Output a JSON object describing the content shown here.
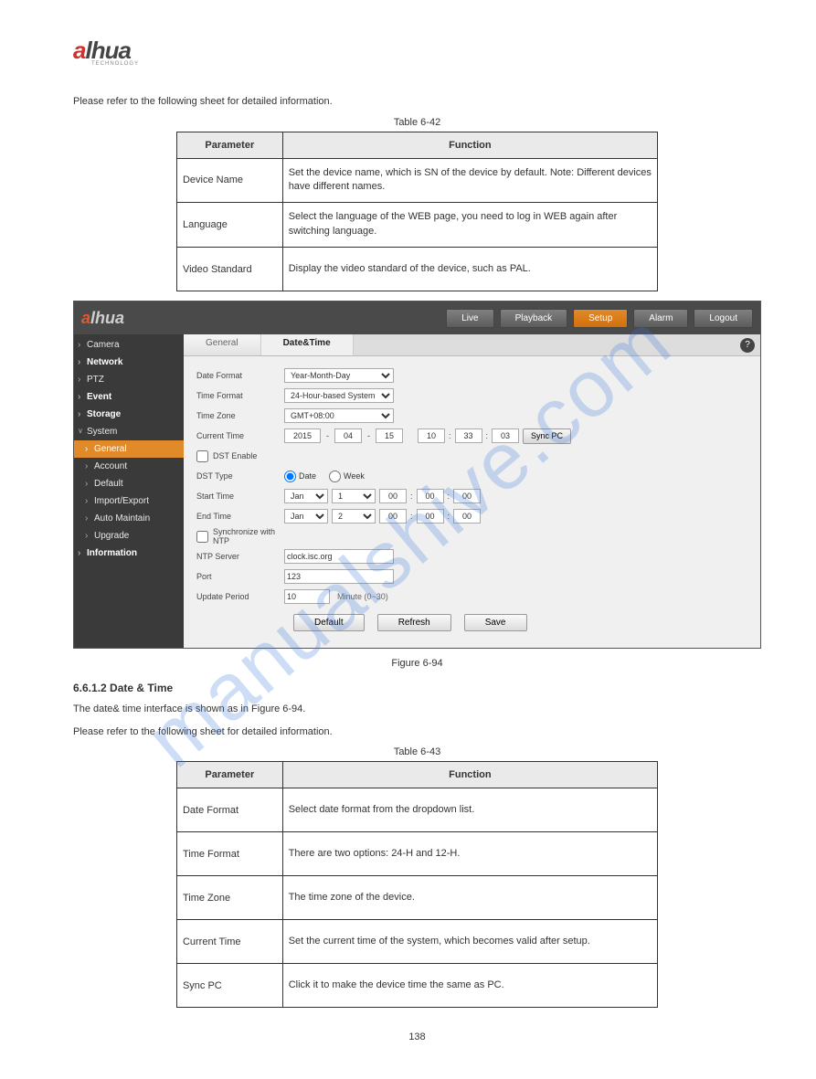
{
  "logo": {
    "brand_hua": "lhua",
    "brand_a": "a",
    "brand_sub": "TECHNOLOGY"
  },
  "intro_text": "Please refer to the following sheet for detailed information.",
  "table1_caption": "Table 6-42",
  "table1": {
    "header_param": "Parameter",
    "header_func": "Function",
    "rows": [
      {
        "param": "Device Name",
        "func": "Set the device name, which is SN of the device by default. Note: Different devices have different names."
      },
      {
        "param": "Language",
        "func": "Select the language of the WEB page, you need to log in WEB again after switching language."
      },
      {
        "param": "Video Standard",
        "func": "Display the video standard of the device, such as PAL."
      }
    ]
  },
  "section_heading": "6.6.1.2 Date & Time",
  "section_text": "The date& time interface is shown as in Figure 6-94.",
  "figure_caption": "Figure 6-94",
  "table2_caption": "Table 6-43",
  "table2": {
    "header_param": "Parameter",
    "header_func": "Function",
    "rows": [
      {
        "param": "Date Format",
        "func": "Select date format from the dropdown list."
      },
      {
        "param": "Time Format",
        "func": "There are two options: 24-H and 12-H."
      },
      {
        "param": "Time Zone",
        "func": "The time zone of the device."
      },
      {
        "param": "Current Time",
        "func": "Set the current time of the system, which becomes valid after setup."
      },
      {
        "param": "Sync PC",
        "func": "Click it to make the device time the same as PC."
      }
    ]
  },
  "screenshot": {
    "nav": {
      "live": "Live",
      "playback": "Playback",
      "setup": "Setup",
      "alarm": "Alarm",
      "logout": "Logout"
    },
    "sidebar": {
      "camera": "Camera",
      "network": "Network",
      "ptz": "PTZ",
      "event": "Event",
      "storage": "Storage",
      "system": "System",
      "general": "General",
      "account": "Account",
      "default": "Default",
      "importexport": "Import/Export",
      "automaintain": "Auto Maintain",
      "upgrade": "Upgrade",
      "information": "Information"
    },
    "tabs": {
      "general": "General",
      "datetime": "Date&Time"
    },
    "help_icon": "?",
    "form": {
      "date_format_label": "Date Format",
      "date_format_value": "Year-Month-Day",
      "time_format_label": "Time Format",
      "time_format_value": "24-Hour-based System",
      "time_zone_label": "Time Zone",
      "time_zone_value": "GMT+08:00",
      "current_time_label": "Current Time",
      "ct_y": "2015",
      "ct_m": "04",
      "ct_d": "15",
      "ct_h": "10",
      "ct_mi": "33",
      "ct_s": "03",
      "sync_pc_btn": "Sync PC",
      "dst_enable_label": "DST Enable",
      "dst_type_label": "DST Type",
      "dst_date": "Date",
      "dst_week": "Week",
      "start_time_label": "Start Time",
      "st_month": "Jan",
      "st_day": "1",
      "st_h": "00",
      "st_m": "00",
      "st_s": "00",
      "end_time_label": "End Time",
      "et_month": "Jan",
      "et_day": "2",
      "et_h": "00",
      "et_m": "00",
      "et_s": "00",
      "sync_ntp_label": "Synchronize with NTP",
      "ntp_server_label": "NTP Server",
      "ntp_server_value": "clock.isc.org",
      "port_label": "Port",
      "port_value": "123",
      "update_period_label": "Update Period",
      "update_period_value": "10",
      "update_period_hint": "Minute (0~30)",
      "default_btn": "Default",
      "refresh_btn": "Refresh",
      "save_btn": "Save"
    }
  },
  "watermark": "manualshive.com",
  "page_number": "138"
}
